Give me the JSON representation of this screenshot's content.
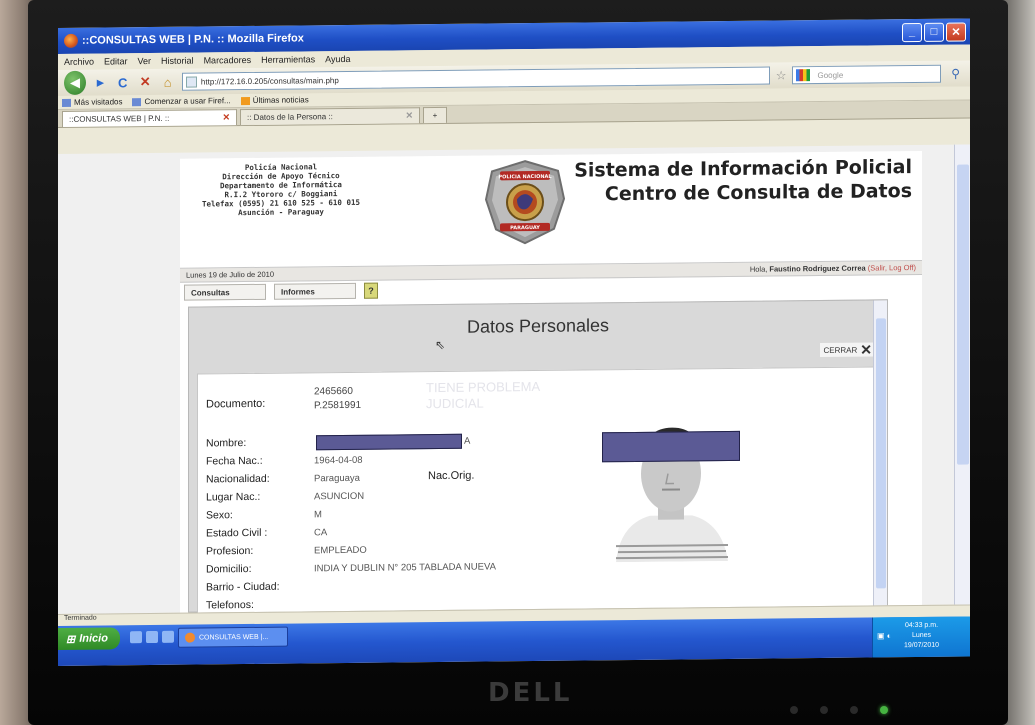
{
  "window": {
    "title": "::CONSULTAS WEB | P.N. ::   Mozilla Firefox"
  },
  "menu": [
    "Archivo",
    "Editar",
    "Ver",
    "Historial",
    "Marcadores",
    "Herramientas",
    "Ayuda"
  ],
  "nav": {
    "url": "http://172.16.0.205/consultas/main.php",
    "search_placeholder": "Google"
  },
  "bookmarks": [
    "Más visitados",
    "Comenzar a usar Firef...",
    "Últimas noticias"
  ],
  "tabs": [
    {
      "label": "::CONSULTAS WEB | P.N. ::"
    },
    {
      "label": ":: Datos de la Persona ::"
    }
  ],
  "header": {
    "institution": [
      "Policía Nacional",
      "Dirección de Apoyo Técnico",
      "Departamento de Informática",
      "R.I.2 Ytororo c/ Boggiani",
      "Telefax (0595) 21 610 525 - 610 015",
      "Asunción - Paraguay"
    ],
    "badge_top": "POLICIA NACIONAL",
    "badge_bottom": "PARAGUAY",
    "title_line1": "Sistema de Información Policial",
    "title_line2": "Centro de Consulta de Datos"
  },
  "datebar": {
    "date": "Lunes 19 de Julio de 2010",
    "greeting": "Hola,",
    "user": "Faustino Rodriguez Correa",
    "actions": "(Salir, Log Off)"
  },
  "page_menu": [
    "Consultas",
    "Informes"
  ],
  "modal": {
    "title": "Datos Personales",
    "close_label": "CERRAR",
    "document_label": "Documento:",
    "document_values": [
      "2465660",
      "P.2581991"
    ],
    "problem_note": [
      "TIENE PROBLEMA",
      "JUDICIAL"
    ],
    "nac_orig": "Nac.Orig.",
    "fields": [
      {
        "label": "Nombre:",
        "value": "A"
      },
      {
        "label": "Fecha Nac.:",
        "value": "1964-04-08"
      },
      {
        "label": "Nacionalidad:",
        "value": "Paraguaya"
      },
      {
        "label": "Lugar Nac.:",
        "value": "ASUNCION"
      },
      {
        "label": "Sexo:",
        "value": "M"
      },
      {
        "label": "Estado Civil :",
        "value": "CA"
      },
      {
        "label": "Profesion:",
        "value": "EMPLEADO"
      },
      {
        "label": "Domicilio:",
        "value": "INDIA Y DUBLIN N° 205 TABLADA NUEVA"
      },
      {
        "label": "Barrio - Ciudad:",
        "value": ""
      },
      {
        "label": "Telefonos:",
        "value": ""
      }
    ]
  },
  "statusbar": "Terminado",
  "taskbar": {
    "start": "Inicio",
    "task": "CONSULTAS WEB |...",
    "time": "04:33 p.m.",
    "day": "Lunes",
    "date": "19/07/2010"
  },
  "monitor": {
    "brand": "DELL"
  },
  "colors": {
    "xp_blue": "#2457cf",
    "redaction": "#5b5a95",
    "badge_gold": "#c8a04a"
  }
}
